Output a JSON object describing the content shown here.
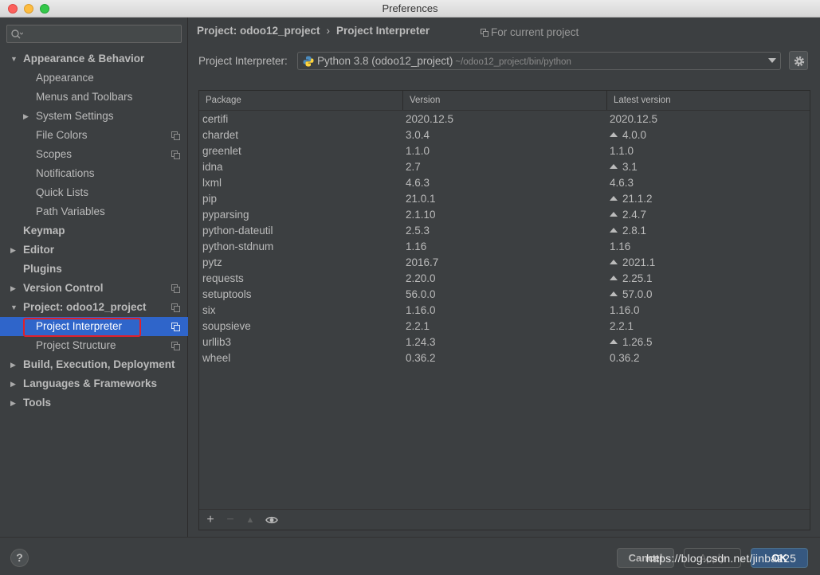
{
  "window": {
    "title": "Preferences"
  },
  "search": {
    "placeholder": ""
  },
  "sidebar": {
    "items": [
      {
        "label": "Appearance & Behavior",
        "level": 0,
        "bold": true,
        "arrow": "expanded",
        "copy": false
      },
      {
        "label": "Appearance",
        "level": 1,
        "bold": false,
        "arrow": "none",
        "copy": false
      },
      {
        "label": "Menus and Toolbars",
        "level": 1,
        "bold": false,
        "arrow": "none",
        "copy": false
      },
      {
        "label": "System Settings",
        "level": 1,
        "bold": false,
        "arrow": "collapsed",
        "copy": false
      },
      {
        "label": "File Colors",
        "level": 1,
        "bold": false,
        "arrow": "none",
        "copy": true
      },
      {
        "label": "Scopes",
        "level": 1,
        "bold": false,
        "arrow": "none",
        "copy": true
      },
      {
        "label": "Notifications",
        "level": 1,
        "bold": false,
        "arrow": "none",
        "copy": false
      },
      {
        "label": "Quick Lists",
        "level": 1,
        "bold": false,
        "arrow": "none",
        "copy": false
      },
      {
        "label": "Path Variables",
        "level": 1,
        "bold": false,
        "arrow": "none",
        "copy": false
      },
      {
        "label": "Keymap",
        "level": 0,
        "bold": true,
        "arrow": "none",
        "copy": false
      },
      {
        "label": "Editor",
        "level": 0,
        "bold": true,
        "arrow": "collapsed",
        "copy": false
      },
      {
        "label": "Plugins",
        "level": 0,
        "bold": true,
        "arrow": "none",
        "copy": false
      },
      {
        "label": "Version Control",
        "level": 0,
        "bold": true,
        "arrow": "collapsed",
        "copy": true
      },
      {
        "label": "Project: odoo12_project",
        "level": 0,
        "bold": true,
        "arrow": "expanded",
        "copy": true
      },
      {
        "label": "Project Interpreter",
        "level": 1,
        "bold": false,
        "arrow": "none",
        "copy": true,
        "selected": true
      },
      {
        "label": "Project Structure",
        "level": 1,
        "bold": false,
        "arrow": "none",
        "copy": true
      },
      {
        "label": "Build, Execution, Deployment",
        "level": 0,
        "bold": true,
        "arrow": "collapsed",
        "copy": false
      },
      {
        "label": "Languages & Frameworks",
        "level": 0,
        "bold": true,
        "arrow": "collapsed",
        "copy": false
      },
      {
        "label": "Tools",
        "level": 0,
        "bold": true,
        "arrow": "collapsed",
        "copy": false
      }
    ]
  },
  "breadcrumb": {
    "project": "Project: odoo12_project",
    "separator": "›",
    "page": "Project Interpreter"
  },
  "scope_note": "For current project",
  "interpreter": {
    "label": "Project Interpreter:",
    "name": "Python 3.8 (odoo12_project)",
    "path": "~/odoo12_project/bin/python"
  },
  "table": {
    "columns": [
      "Package",
      "Version",
      "Latest version"
    ],
    "rows": [
      {
        "package": "certifi",
        "version": "2020.12.5",
        "latest": "2020.12.5",
        "upgrade": false
      },
      {
        "package": "chardet",
        "version": "3.0.4",
        "latest": "4.0.0",
        "upgrade": true
      },
      {
        "package": "greenlet",
        "version": "1.1.0",
        "latest": "1.1.0",
        "upgrade": false
      },
      {
        "package": "idna",
        "version": "2.7",
        "latest": "3.1",
        "upgrade": true
      },
      {
        "package": "lxml",
        "version": "4.6.3",
        "latest": "4.6.3",
        "upgrade": false
      },
      {
        "package": "pip",
        "version": "21.0.1",
        "latest": "21.1.2",
        "upgrade": true
      },
      {
        "package": "pyparsing",
        "version": "2.1.10",
        "latest": "2.4.7",
        "upgrade": true
      },
      {
        "package": "python-dateutil",
        "version": "2.5.3",
        "latest": "2.8.1",
        "upgrade": true
      },
      {
        "package": "python-stdnum",
        "version": "1.16",
        "latest": "1.16",
        "upgrade": false
      },
      {
        "package": "pytz",
        "version": "2016.7",
        "latest": "2021.1",
        "upgrade": true
      },
      {
        "package": "requests",
        "version": "2.20.0",
        "latest": "2.25.1",
        "upgrade": true
      },
      {
        "package": "setuptools",
        "version": "56.0.0",
        "latest": "57.0.0",
        "upgrade": true
      },
      {
        "package": "six",
        "version": "1.16.0",
        "latest": "1.16.0",
        "upgrade": false
      },
      {
        "package": "soupsieve",
        "version": "2.2.1",
        "latest": "2.2.1",
        "upgrade": false
      },
      {
        "package": "urllib3",
        "version": "1.24.3",
        "latest": "1.26.5",
        "upgrade": true
      },
      {
        "package": "wheel",
        "version": "0.36.2",
        "latest": "0.36.2",
        "upgrade": false
      }
    ]
  },
  "toolbar": {
    "add": "+",
    "remove": "−",
    "upgrade": "▲",
    "show": "eye-icon"
  },
  "buttons": {
    "help": "?",
    "cancel": "Cancel",
    "apply": "Apply",
    "ok": "OK"
  },
  "watermark": "https://blog.csdn.net/jinba225",
  "colors": {
    "background": "#3c3f41",
    "selection": "#2f65ca",
    "highlight_box": "#e0202b",
    "ok_button": "#365880"
  }
}
